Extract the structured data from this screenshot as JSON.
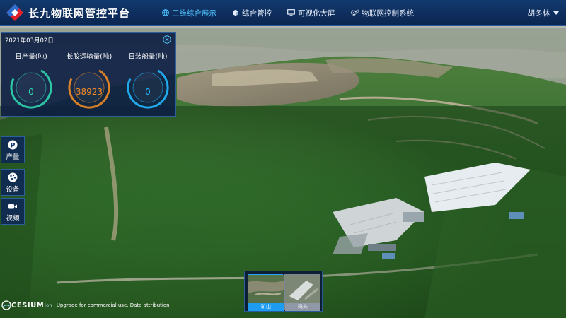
{
  "app": {
    "title": "长九物联网管控平台"
  },
  "nav": [
    {
      "label": "三维综合展示",
      "icon": "globe-icon",
      "active": true
    },
    {
      "label": "综合管控",
      "icon": "cube-icon",
      "active": false
    },
    {
      "label": "可视化大屏",
      "icon": "monitor-icon",
      "active": false
    },
    {
      "label": "物联网控制系统",
      "icon": "gears-icon",
      "active": false
    }
  ],
  "user": {
    "name": "胡冬林"
  },
  "stats": {
    "date": "2021年03月02日",
    "gauges": [
      {
        "label": "日产量(吨)",
        "value": "0",
        "color": "#2fd6b0"
      },
      {
        "label": "长胶运输量(吨)",
        "value": "38923",
        "color": "#f08a24"
      },
      {
        "label": "日装船量(吨)",
        "value": "0",
        "color": "#22b8ff"
      }
    ]
  },
  "side_tools": [
    {
      "label": "产量",
      "icon": "parking-p-icon"
    },
    {
      "label": "设备",
      "icon": "palette-icon"
    },
    {
      "label": "视频",
      "icon": "video-camera-icon"
    }
  ],
  "credit": {
    "logo": "CESIUM",
    "logo_suffix": "ion",
    "text": "Upgrade for commercial use.",
    "link": "Data attribution"
  },
  "basemaps": [
    {
      "label": "矿山",
      "active": true
    },
    {
      "label": "码头",
      "active": false
    }
  ],
  "colors": {
    "topbar": "#0f3366",
    "accent": "#4fc3ff",
    "panel": "#0c1e42"
  }
}
